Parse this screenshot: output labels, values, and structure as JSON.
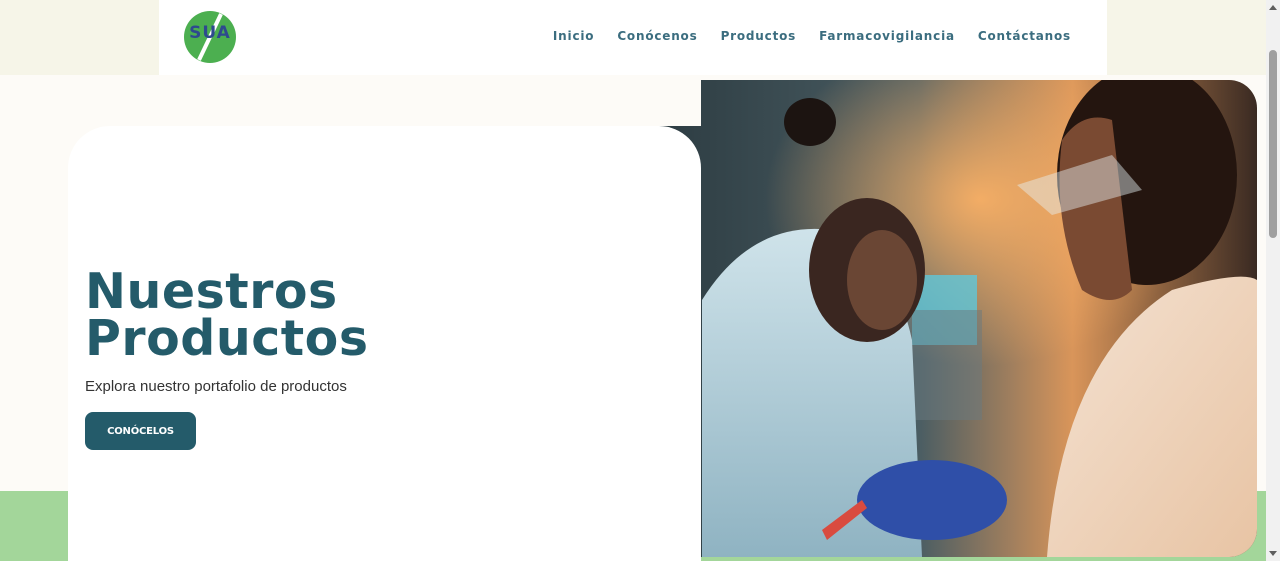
{
  "header": {
    "logo_text": "SUA",
    "logo_icon": "sua-logo-icon",
    "nav": [
      {
        "label": "Inicio"
      },
      {
        "label": "Conócenos"
      },
      {
        "label": "Productos"
      },
      {
        "label": "Farmacovigilancia"
      },
      {
        "label": "Contáctanos"
      }
    ]
  },
  "hero": {
    "title_line1": "Nuestros",
    "title_line2": "Productos",
    "subtitle": "Explora nuestro portafolio de productos",
    "cta_label": "CONÓCELOS",
    "image": "lab-scientists-image"
  },
  "colors": {
    "brand_teal": "#245b6a",
    "nav_text": "#3b6d7f",
    "logo_green": "#4caf50",
    "logo_blue": "#2e4a8e",
    "band_green": "#a3d69a",
    "band_cream": "#f6f5e8"
  }
}
